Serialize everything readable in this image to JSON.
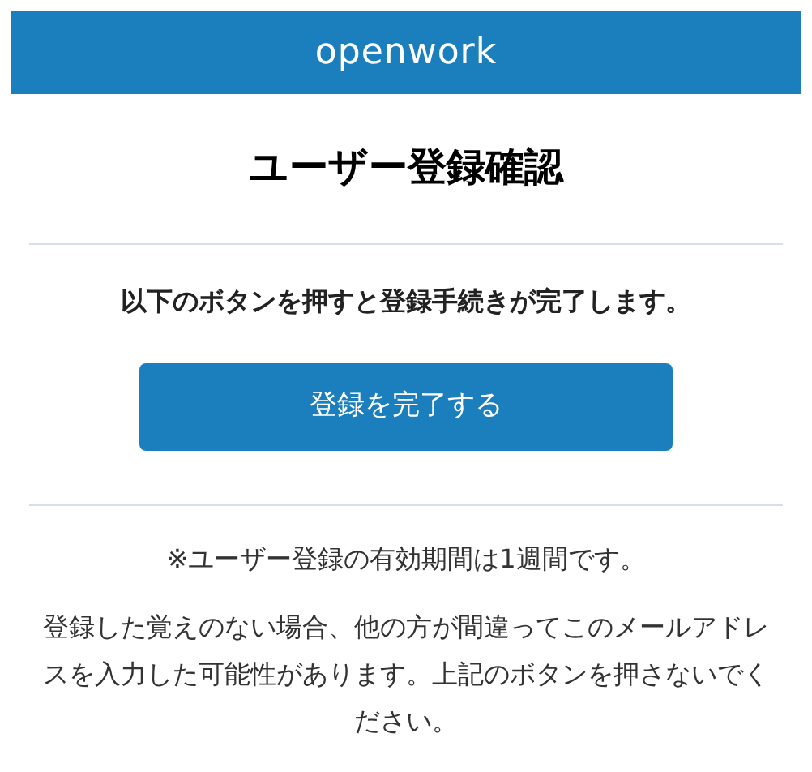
{
  "header": {
    "logo": "openwork"
  },
  "title": "ユーザー登録確認",
  "instruction": "以下のボタンを押すと登録手続きが完了します。",
  "button": {
    "label": "登録を完了する"
  },
  "notes": [
    "※ユーザー登録の有効期間は1週間です。",
    "登録した覚えのない場合、他の方が間違ってこのメールアドレスを入力した可能性があります。上記のボタンを押さないでください。"
  ]
}
